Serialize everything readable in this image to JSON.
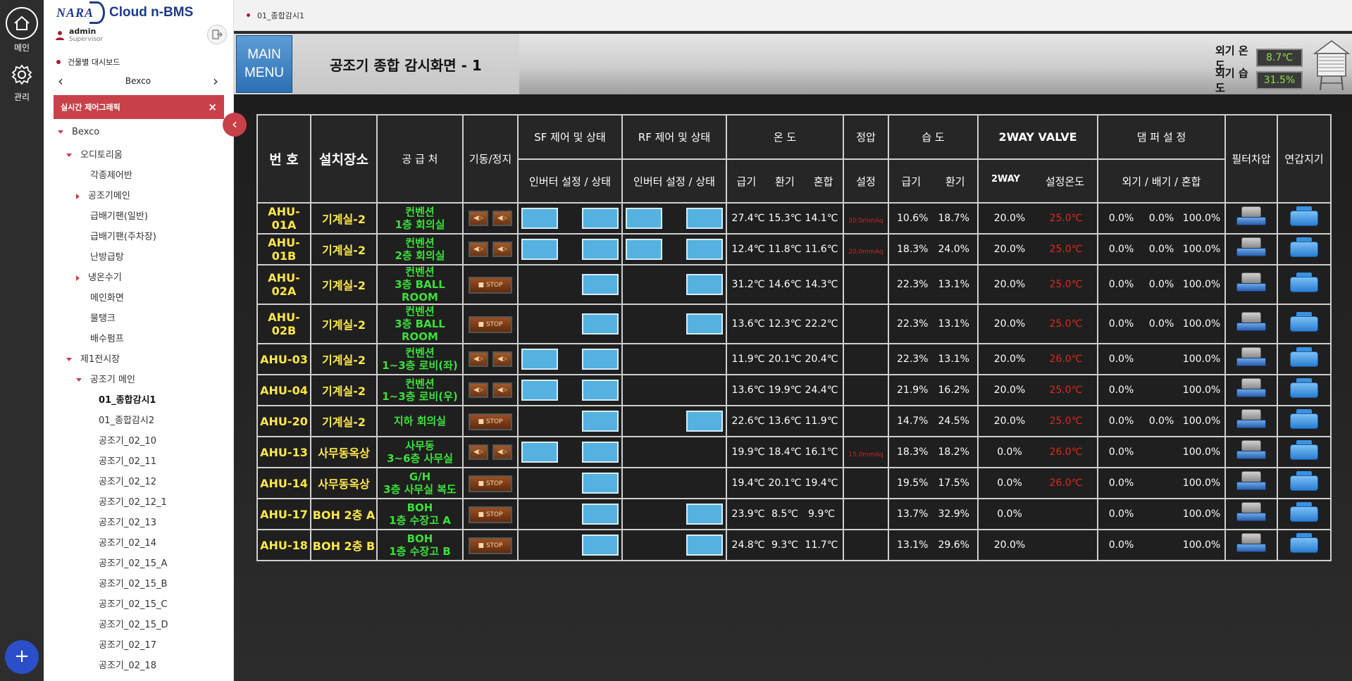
{
  "rail": {
    "home_label": "메인",
    "admin_label": "관리",
    "add_label": "+"
  },
  "sidebar": {
    "logo_brand": "NARA",
    "logo_product": "Cloud n-BMS",
    "user_name": "admin",
    "user_role": "Supervisor",
    "dashboard_label": "건물별 대시보드",
    "building": "Bexco",
    "realtime_tab": "실시간 제어그래픽",
    "tree": [
      {
        "label": "Bexco",
        "level": 0,
        "icon": "down"
      },
      {
        "label": "오디토리움",
        "level": 1,
        "icon": "down"
      },
      {
        "label": "각종제어반",
        "level": 2,
        "icon": ""
      },
      {
        "label": "공조기메인",
        "level": 2,
        "icon": "right"
      },
      {
        "label": "급배기팬(일반)",
        "level": 2,
        "icon": ""
      },
      {
        "label": "급배기팬(주차장)",
        "level": 2,
        "icon": ""
      },
      {
        "label": "난방급탕",
        "level": 2,
        "icon": ""
      },
      {
        "label": "냉온수기",
        "level": 2,
        "icon": "right"
      },
      {
        "label": "메인화면",
        "level": 2,
        "icon": ""
      },
      {
        "label": "물탱크",
        "level": 2,
        "icon": ""
      },
      {
        "label": "배수펌프",
        "level": 2,
        "icon": ""
      },
      {
        "label": "제1전시장",
        "level": 1,
        "icon": "down"
      },
      {
        "label": "공조기 메인",
        "level": 2,
        "icon": "down"
      },
      {
        "label": "01_종합감시1",
        "level": 3,
        "icon": "",
        "selected": true
      },
      {
        "label": "01_종합감시2",
        "level": 3,
        "icon": ""
      },
      {
        "label": "공조기_02_10",
        "level": 3,
        "icon": ""
      },
      {
        "label": "공조기_02_11",
        "level": 3,
        "icon": ""
      },
      {
        "label": "공조기_02_12",
        "level": 3,
        "icon": ""
      },
      {
        "label": "공조기_02_12_1",
        "level": 3,
        "icon": ""
      },
      {
        "label": "공조기_02_13",
        "level": 3,
        "icon": ""
      },
      {
        "label": "공조기_02_14",
        "level": 3,
        "icon": ""
      },
      {
        "label": "공조기_02_15_A",
        "level": 3,
        "icon": ""
      },
      {
        "label": "공조기_02_15_B",
        "level": 3,
        "icon": ""
      },
      {
        "label": "공조기_02_15_C",
        "level": 3,
        "icon": ""
      },
      {
        "label": "공조기_02_15_D",
        "level": 3,
        "icon": ""
      },
      {
        "label": "공조기_02_17",
        "level": 3,
        "icon": ""
      },
      {
        "label": "공조기_02_18",
        "level": 3,
        "icon": ""
      }
    ]
  },
  "breadcrumb": "01_종합감시1",
  "header": {
    "main_menu_line1": "MAIN",
    "main_menu_line2": "MENU",
    "title": "공조기 종합 감시화면 - 1",
    "ext_temp_label": "외기 온도",
    "ext_temp_value": "8.7℃",
    "ext_humi_label": "외기 습도",
    "ext_humi_value": "31.5%"
  },
  "table": {
    "headers": {
      "no": "번  호",
      "location": "설치장소",
      "supply": "공 급 처",
      "run_stop": "기동/정지",
      "sf": "SF 제어 및 상태",
      "rf": "RF 제어 및 상태",
      "temp": "온 도",
      "static": "정압",
      "humi": "습 도",
      "twoway": "2WAY VALVE",
      "damper": "댐 퍼 설 정",
      "filter": "필터차압",
      "humidifier": "연갑지기",
      "sf_sub": "인버터 설정 / 상태",
      "rf_sub": "인버터 설정 / 상태",
      "temp_sub": [
        "급기",
        "환기",
        "혼합"
      ],
      "static_sub": "설정",
      "humi_sub": [
        "급기",
        "환기"
      ],
      "twoway_sub": [
        "2WAY",
        "설정온도"
      ],
      "damper_sub": "외기 / 배기 / 혼합"
    },
    "rows": [
      {
        "id": "AHU-01A",
        "loc": "기계실-2",
        "sup1": "컨벤션",
        "sup2": "1층 회의실",
        "ctl": "pair",
        "sf": [
          true,
          true
        ],
        "rf": [
          true,
          true
        ],
        "temp": [
          "27.4℃",
          "15.3℃",
          "14.1℃"
        ],
        "static": "20.0mmAq",
        "humi": [
          "10.6%",
          "18.7%"
        ],
        "twoway": [
          "20.0%",
          "25.0℃"
        ],
        "damper": [
          "0.0%",
          "0.0%",
          "100.0%"
        ]
      },
      {
        "id": "AHU-01B",
        "loc": "기계실-2",
        "sup1": "컨벤션",
        "sup2": "2층 회의실",
        "ctl": "pair",
        "sf": [
          true,
          true
        ],
        "rf": [
          true,
          true
        ],
        "temp": [
          "12.4℃",
          "11.8℃",
          "11.6℃"
        ],
        "static": "20.0mmAq",
        "humi": [
          "18.3%",
          "24.0%"
        ],
        "twoway": [
          "20.0%",
          "25.0℃"
        ],
        "damper": [
          "0.0%",
          "0.0%",
          "100.0%"
        ]
      },
      {
        "id": "AHU-02A",
        "loc": "기계실-2",
        "sup1": "컨벤션",
        "sup2": "3층 BALL ROOM",
        "ctl": "stop",
        "sf": [
          false,
          true
        ],
        "rf": [
          false,
          true
        ],
        "temp": [
          "31.2℃",
          "14.6℃",
          "14.3℃"
        ],
        "static": "",
        "humi": [
          "22.3%",
          "13.1%"
        ],
        "twoway": [
          "20.0%",
          "25.0℃"
        ],
        "damper": [
          "0.0%",
          "0.0%",
          "100.0%"
        ]
      },
      {
        "id": "AHU-02B",
        "loc": "기계실-2",
        "sup1": "컨벤션",
        "sup2": "3층 BALL ROOM",
        "ctl": "stop",
        "sf": [
          false,
          true
        ],
        "rf": [
          false,
          true
        ],
        "temp": [
          "13.6℃",
          "12.3℃",
          "22.2℃"
        ],
        "static": "",
        "humi": [
          "22.3%",
          "13.1%"
        ],
        "twoway": [
          "20.0%",
          "25.0℃"
        ],
        "damper": [
          "0.0%",
          "0.0%",
          "100.0%"
        ]
      },
      {
        "id": "AHU-03",
        "loc": "기계실-2",
        "sup1": "컨벤션",
        "sup2": "1~3층 로비(좌)",
        "ctl": "pair",
        "sf": [
          true,
          true
        ],
        "rf": [
          false,
          false
        ],
        "temp": [
          "11.9℃",
          "20.1℃",
          "20.4℃"
        ],
        "static": "",
        "humi": [
          "22.3%",
          "13.1%"
        ],
        "twoway": [
          "20.0%",
          "26.0℃"
        ],
        "damper": [
          "0.0%",
          "",
          "100.0%"
        ]
      },
      {
        "id": "AHU-04",
        "loc": "기계실-2",
        "sup1": "컨벤션",
        "sup2": "1~3층 로비(우)",
        "ctl": "pair",
        "sf": [
          true,
          true
        ],
        "rf": [
          false,
          false
        ],
        "temp": [
          "13.6℃",
          "19.9℃",
          "24.4℃"
        ],
        "static": "",
        "humi": [
          "21.9%",
          "16.2%"
        ],
        "twoway": [
          "20.0%",
          "25.0℃"
        ],
        "damper": [
          "0.0%",
          "",
          "100.0%"
        ]
      },
      {
        "id": "AHU-20",
        "loc": "기계실-2",
        "sup1": "지하 회의실",
        "sup2": "",
        "ctl": "stop",
        "sf": [
          false,
          true
        ],
        "rf": [
          false,
          true
        ],
        "temp": [
          "22.6℃",
          "13.6℃",
          "11.9℃"
        ],
        "static": "",
        "humi": [
          "14.7%",
          "24.5%"
        ],
        "twoway": [
          "20.0%",
          "25.0℃"
        ],
        "damper": [
          "0.0%",
          "0.0%",
          "100.0%"
        ]
      },
      {
        "id": "AHU-13",
        "loc": "사무동옥상",
        "sup1": "사무동",
        "sup2": "3~6층 사무실",
        "ctl": "pair",
        "sf": [
          true,
          true
        ],
        "rf": [
          false,
          false
        ],
        "temp": [
          "19.9℃",
          "18.4℃",
          "16.1℃"
        ],
        "static": "15.0mmAq",
        "humi": [
          "18.3%",
          "18.2%"
        ],
        "twoway": [
          "0.0%",
          "26.0℃"
        ],
        "damper": [
          "0.0%",
          "",
          "100.0%"
        ]
      },
      {
        "id": "AHU-14",
        "loc": "사무동옥상",
        "sup1": "G/H",
        "sup2": "3층 사무실 복도",
        "ctl": "stop",
        "sf": [
          false,
          true
        ],
        "rf": [
          false,
          false
        ],
        "temp": [
          "19.4℃",
          "20.1℃",
          "19.4℃"
        ],
        "static": "",
        "humi": [
          "19.5%",
          "17.5%"
        ],
        "twoway": [
          "0.0%",
          "26.0℃"
        ],
        "damper": [
          "0.0%",
          "",
          "100.0%"
        ]
      },
      {
        "id": "AHU-17",
        "loc": "BOH 2층 A",
        "sup1": "BOH",
        "sup2": "1층 수장고 A",
        "ctl": "stop",
        "sf": [
          false,
          true
        ],
        "rf": [
          false,
          true
        ],
        "temp": [
          "23.9℃",
          "8.5℃",
          "9.9℃"
        ],
        "static": "",
        "humi": [
          "13.7%",
          "32.9%"
        ],
        "twoway": [
          "0.0%",
          ""
        ],
        "damper": [
          "0.0%",
          "",
          "100.0%"
        ]
      },
      {
        "id": "AHU-18",
        "loc": "BOH 2층 B",
        "sup1": "BOH",
        "sup2": "1층 수장고 B",
        "ctl": "stop",
        "sf": [
          false,
          true
        ],
        "rf": [
          false,
          true
        ],
        "temp": [
          "24.8℃",
          "9.3℃",
          "11.7℃"
        ],
        "static": "",
        "humi": [
          "13.1%",
          "29.6%"
        ],
        "twoway": [
          "20.0%",
          ""
        ],
        "damper": [
          "0.0%",
          "",
          "100.0%"
        ]
      }
    ],
    "stop_label": "■ STOP",
    "on_label": "◀▷",
    "off_label": "◀▷"
  }
}
